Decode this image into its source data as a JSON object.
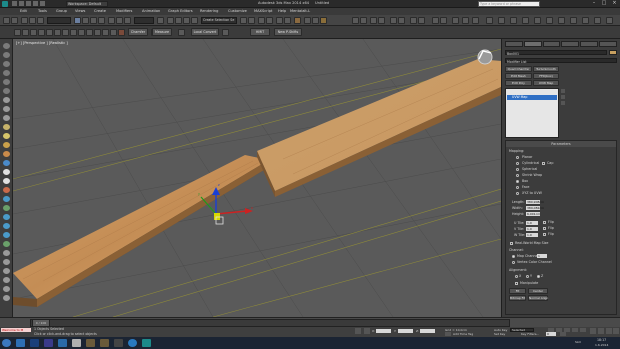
{
  "titlebar": {
    "workspace": "Workspace: Default",
    "app_title": "Autodesk 3ds Max 2014 x64",
    "file": "Untitled",
    "search_placeholder": "Type a keyword or phrase"
  },
  "menus": [
    "Edit",
    "Tools",
    "Group",
    "Views",
    "Create",
    "Modifiers",
    "Animation",
    "Graph Editors",
    "Rendering",
    "Customize",
    "MAXScript",
    "Help",
    "Mentalalt-L"
  ],
  "toolbar": {
    "selection_set": "Create Selection Se"
  },
  "ribbon": {
    "buttons": [
      "Chamfer",
      "Measure",
      "Local Convert",
      "HMIT",
      "New P-Shifts"
    ]
  },
  "viewport": {
    "label": "[+] [Perspective ] [Realistic ]",
    "axis_labels": [
      "x",
      "y",
      "z"
    ]
  },
  "cmdpanel": {
    "object_name": "Box001",
    "modifier_list": "Modifier List",
    "quick_buttons": [
      "Quad Chamfer",
      "TurboSmooth",
      "Edit Mesh",
      "FFD(box)",
      "Edit Poly",
      "UVW Map"
    ],
    "stack_item": "UVW Map",
    "rollout_title": "Parameters",
    "mapping_label": "Mapping:",
    "mapping_options": [
      "Planar",
      "Cylindrical",
      "Cap",
      "Spherical",
      "Shrink Wrap",
      "Box",
      "Face",
      "XYZ to UVW"
    ],
    "selected_mapping": "Box",
    "fields": [
      {
        "label": "Length:",
        "value": "380,908cm"
      },
      {
        "label": "Width:",
        "value": "389,082cm"
      },
      {
        "label": "Height:",
        "value": "6,001cm"
      }
    ],
    "tiles": [
      {
        "label": "U Tile:",
        "value": "1,0"
      },
      {
        "label": "V Tile:",
        "value": "1,0"
      },
      {
        "label": "W Tile:",
        "value": "1,0"
      }
    ],
    "flip": "Flip",
    "real_world": "Real-World Map Size",
    "channel_label": "Channel:",
    "map_channel": "Map Channel:",
    "map_channel_value": "1",
    "vertex_color": "Vertex Color Channel",
    "alignment_label": "Alignment:",
    "axes": [
      "X",
      "Y",
      "Z"
    ],
    "manipulate": "Manipulate",
    "fit": "Fit",
    "center": "Center",
    "bitmap_fit": "Bitmap Fit",
    "normal_align": "Normal Align"
  },
  "timeline": {
    "frame": "0 / 100"
  },
  "status": {
    "maxscript": "Welcome to M",
    "selected": "1 Objects Selected",
    "prompt": "Click or click-and-drag to select objects",
    "x_label": "X:",
    "y_label": "Y:",
    "z_label": "Z:",
    "grid": "Grid = 10,0cm",
    "autokey": "Auto Key",
    "set_key": "Set Key",
    "key_filters": "Key Filters...",
    "selected_dropdown": "Selected",
    "add_time_tag": "Add Time Tag",
    "frame_field": "0"
  },
  "taskbar": {
    "time": "18:17",
    "date": "1.6.2014",
    "lang": "SLO"
  },
  "colors": {
    "wood": "#c9965f",
    "accent": "#0f65a8",
    "grid_line": "#3f3f3f",
    "guide": "#8e8a3a"
  }
}
